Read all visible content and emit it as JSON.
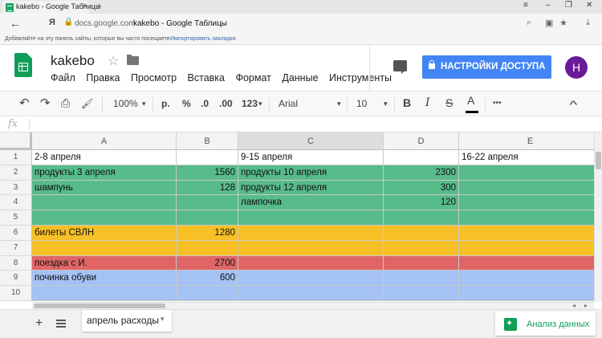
{
  "browser": {
    "tab_title": "kakebo - Google Таблицы",
    "tab_close": "×",
    "new_tab": "+",
    "window_controls": [
      "–",
      "❐",
      "✕"
    ],
    "window_extra_icon": "≡",
    "back": "←",
    "yandex_button": "Я",
    "domain": "docs.google.com",
    "page_title": "kakebo - Google Таблицы",
    "bookmarks_text": "Добавляйте на эту панель сайты, которые вы часто посещаете.",
    "bookmarks_link": "Импортировать закладки"
  },
  "header": {
    "doc_name": "kakebo",
    "star": "☆",
    "menu": [
      "Файл",
      "Правка",
      "Просмотр",
      "Вставка",
      "Формат",
      "Данные",
      "Инструменты"
    ],
    "share_label": "НАСТРОЙКИ ДОСТУПА",
    "avatar_letter": "H"
  },
  "toolbar": {
    "undo": "↶",
    "redo": "↷",
    "print": "⎙",
    "paint": "🖌",
    "zoom": "100%",
    "currency": "р.",
    "percent": "%",
    "dec_less": ".0",
    "dec_more": ".00",
    "format_more": "123",
    "font": "Arial",
    "font_size": "10",
    "bold": "B",
    "italic": "I",
    "strike": "S",
    "text_color": "A",
    "more": "•••",
    "collapse": "^",
    "dropdown": "▾"
  },
  "formula": {
    "fx": "fx",
    "value": ""
  },
  "grid": {
    "columns": [
      "A",
      "B",
      "C",
      "D",
      "E"
    ],
    "rows": [
      "1",
      "2",
      "3",
      "4",
      "5",
      "6",
      "7",
      "8",
      "9",
      "10"
    ],
    "cells": {
      "A1": "2-8 апреля",
      "C1": "9-15 апреля",
      "E1": "16-22 апреля",
      "A2": "продукты 3 апреля",
      "B2": "1560",
      "C2": "продукты 10 апреля",
      "D2": "2300",
      "A3": "шампунь",
      "B3": "128",
      "C3": "продукты 12 апреля",
      "D3": "300",
      "C4": "лампочка",
      "D4": "120",
      "A6": "билеты СВЛН",
      "B6": "1280",
      "A8": "поездка с И.",
      "B8": "2700",
      "A9": "починка обуви",
      "B9": "600"
    },
    "row_colors": {
      "green": "#57bb8a",
      "yellow": "#f6c026",
      "red": "#e06666",
      "blue": "#a4c2f4",
      "white": "#ffffff"
    }
  },
  "bottom": {
    "add_sheet": "+",
    "sheet_name": "апрель расходы",
    "sheet_dropdown": "▾",
    "explore_label": "Анализ данных"
  }
}
